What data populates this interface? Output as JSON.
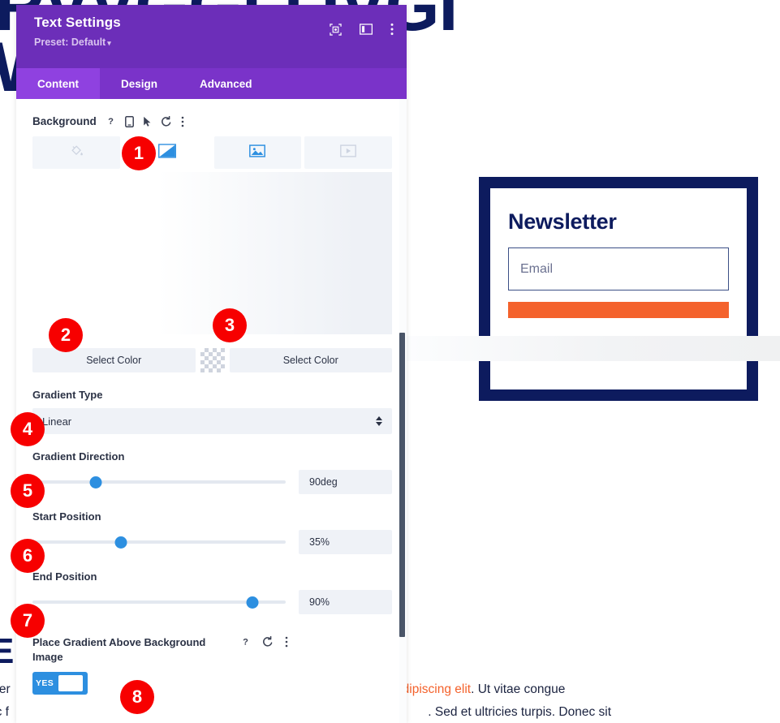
{
  "page_background": {
    "heading_top": "RVVGGLI IVGI",
    "heading_lower": "W",
    "heading_bottom": "E C",
    "body_line_1_left": "nter",
    "body_line_1_right_accent": "adipiscing elit",
    "body_line_1_right_rest": ". Ut vitae congue",
    "body_line_2_left": "ec f",
    "body_line_2_right": ". Sed et ultricies turpis. Donec sit"
  },
  "newsletter": {
    "title": "Newsletter",
    "email_placeholder": "Email",
    "accent_color": "#f4622c",
    "border_color": "#0d1b5e"
  },
  "panel": {
    "title": "Text Settings",
    "preset_label": "Preset: Default",
    "preset_caret": "▾",
    "header_icons": [
      {
        "name": "focus-target-icon",
        "glyph": "⊙"
      },
      {
        "name": "layout-panel-icon",
        "glyph": "▤"
      },
      {
        "name": "overflow-menu-icon",
        "glyph": "⋮"
      }
    ],
    "tabs": [
      {
        "label": "Content",
        "active": true
      },
      {
        "label": "Design",
        "active": false
      },
      {
        "label": "Advanced",
        "active": false
      }
    ],
    "accent_purple": "#6c2eb9",
    "tab_active_purple": "#8f41e0"
  },
  "background_section": {
    "label": "Background",
    "label_icons": [
      {
        "name": "help-icon",
        "glyph": "?"
      },
      {
        "name": "responsive-device-icon",
        "glyph": "▯"
      },
      {
        "name": "hover-cursor-icon",
        "glyph": "➤"
      },
      {
        "name": "reset-icon",
        "glyph": "↺"
      },
      {
        "name": "overflow-menu-icon",
        "glyph": "⋮"
      }
    ],
    "type_tabs": [
      {
        "name": "background-color-tab",
        "icon": "paint-bucket-icon",
        "active": false
      },
      {
        "name": "background-gradient-tab",
        "icon": "gradient-icon",
        "active": true
      },
      {
        "name": "background-image-tab",
        "icon": "image-icon",
        "active": false
      },
      {
        "name": "background-video-tab",
        "icon": "video-icon",
        "active": false
      }
    ]
  },
  "color_row": {
    "left_button_label": "Select Color",
    "right_button_label": "Select Color",
    "swatch_name": "transparency-checker-swatch"
  },
  "fields": {
    "gradient_type": {
      "label": "Gradient Type",
      "value": "Linear"
    },
    "gradient_direction": {
      "label": "Gradient Direction",
      "value": "90deg",
      "handle_percent": 25
    },
    "start_position": {
      "label": "Start Position",
      "value": "35%",
      "handle_percent": 35
    },
    "end_position": {
      "label": "End Position",
      "value": "90%",
      "handle_percent": 87
    }
  },
  "toggle": {
    "label": "Place Gradient Above Background Image",
    "state_label": "YES",
    "icons": [
      {
        "name": "help-icon",
        "glyph": "?"
      },
      {
        "name": "reset-icon",
        "glyph": "↺"
      },
      {
        "name": "overflow-menu-icon",
        "glyph": "⋮"
      }
    ]
  },
  "badges": [
    {
      "number": "1"
    },
    {
      "number": "2"
    },
    {
      "number": "3"
    },
    {
      "number": "4"
    },
    {
      "number": "5"
    },
    {
      "number": "6"
    },
    {
      "number": "7"
    },
    {
      "number": "8"
    }
  ]
}
